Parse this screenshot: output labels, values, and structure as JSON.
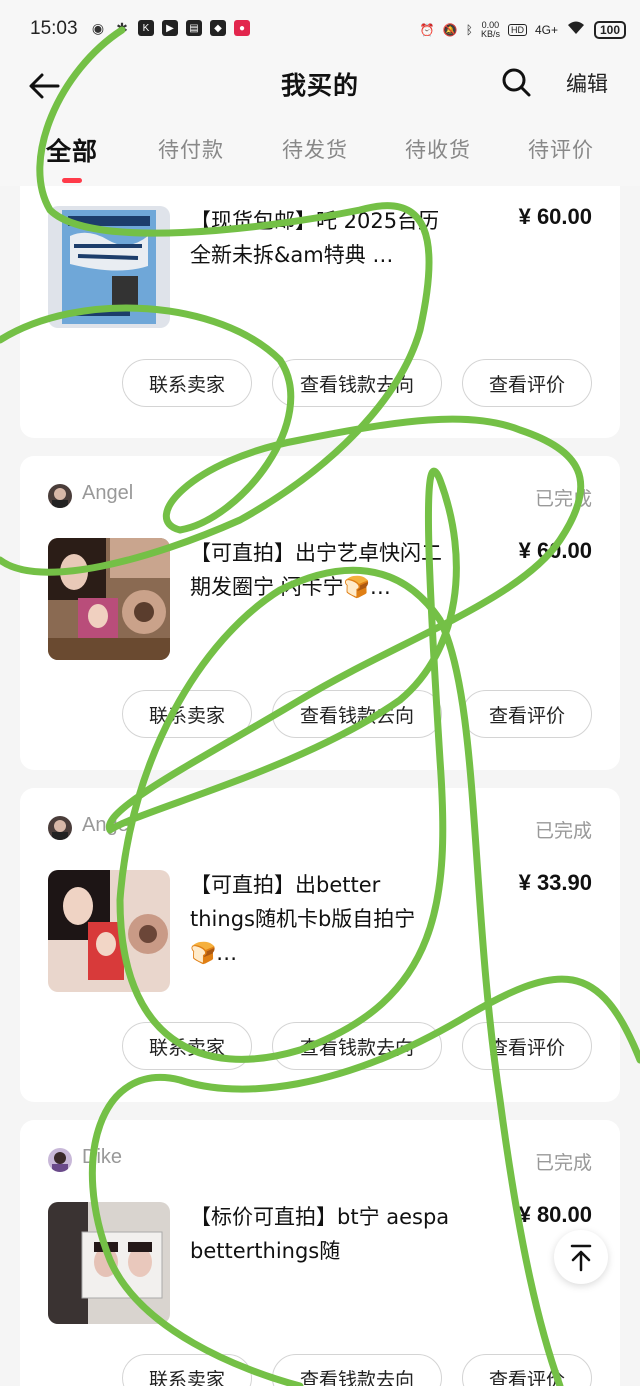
{
  "status_bar": {
    "time": "15:03",
    "net_speed_value": "0.00",
    "net_speed_unit": "KB/s",
    "hd": "HD",
    "network": "4G+",
    "battery": "100"
  },
  "header": {
    "title": "我买的",
    "edit_label": "编辑"
  },
  "tabs": [
    {
      "label": "全部",
      "active": true
    },
    {
      "label": "待付款"
    },
    {
      "label": "待发货"
    },
    {
      "label": "待收货"
    },
    {
      "label": "待评价"
    }
  ],
  "buttons": {
    "contact": "联系卖家",
    "money": "查看钱款去向",
    "review": "查看评价"
  },
  "orders": [
    {
      "title": "【现货包邮】吒 2025台历全新未拆&am特典 …",
      "price": "¥ 60.00"
    },
    {
      "seller": "Angel",
      "status": "已完成",
      "title": "【可直拍】出宁艺卓快闪二期发圈宁 闪卡宁🍞…",
      "price": "¥ 60.00"
    },
    {
      "seller": "Angel",
      "status": "已完成",
      "title": "【可直拍】出better things随机卡b版自拍宁🍞…",
      "price": "¥ 33.90"
    },
    {
      "seller": "Dike",
      "status": "已完成",
      "title": "【标价可直拍】bt宁 aespa betterthings随",
      "price": "¥ 80.00"
    }
  ]
}
